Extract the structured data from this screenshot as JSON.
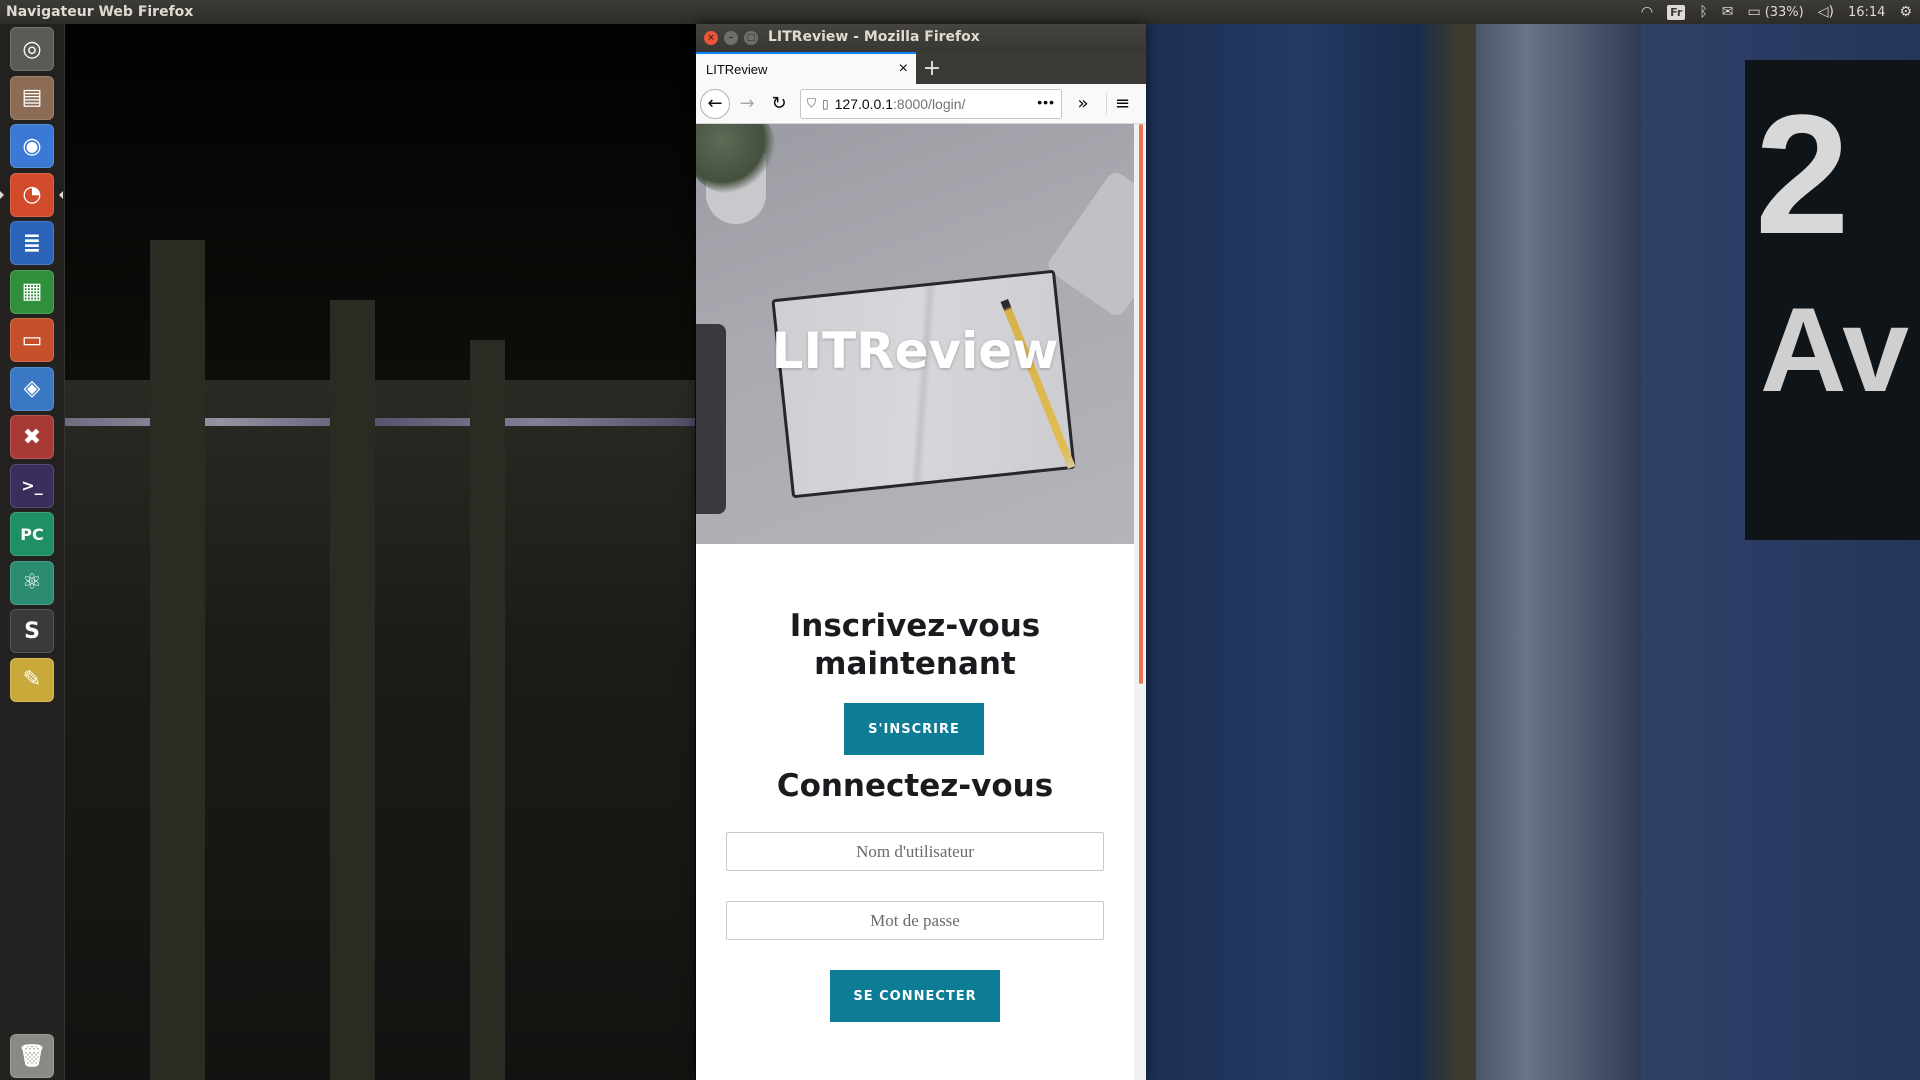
{
  "top_panel": {
    "app_title": "Navigateur Web Firefox",
    "keyboard_layout": "Fr",
    "battery": "(33%)",
    "clock": "16:14"
  },
  "launcher": {
    "items": [
      {
        "name": "dash-home-icon",
        "color": "#5b5a55",
        "glyph": "◎"
      },
      {
        "name": "files-icon",
        "color": "#8c6c55",
        "glyph": "▤"
      },
      {
        "name": "chrome-icon",
        "color": "#3b7ad4",
        "glyph": "◉"
      },
      {
        "name": "firefox-icon",
        "color": "#d24b2b",
        "glyph": "◔"
      },
      {
        "name": "writer-icon",
        "color": "#2a63b8",
        "glyph": "≣"
      },
      {
        "name": "calc-icon",
        "color": "#2f8f3b",
        "glyph": "▦"
      },
      {
        "name": "impress-icon",
        "color": "#c5502a",
        "glyph": "▭"
      },
      {
        "name": "software-center-icon",
        "color": "#3a78c4",
        "glyph": "◈"
      },
      {
        "name": "settings-icon",
        "color": "#a83a36",
        "glyph": "✖"
      },
      {
        "name": "terminal-icon",
        "color": "#3a2f5c",
        "glyph": ">_"
      },
      {
        "name": "pycharm-icon",
        "color": "#1f8f64",
        "glyph": "PC"
      },
      {
        "name": "atom-icon",
        "color": "#2c8c72",
        "glyph": "⚛"
      },
      {
        "name": "sublime-icon",
        "color": "#3a3a3a",
        "glyph": "S"
      },
      {
        "name": "text-editor-icon",
        "color": "#c9a93a",
        "glyph": "✎"
      }
    ],
    "trash_icon": "trash-icon"
  },
  "firefox": {
    "window_title": "LITReview - Mozilla Firefox",
    "tab_label": "LITReview",
    "url_host": "127.0.0.1",
    "url_path": ":8000/login/"
  },
  "page": {
    "hero_title": "LITReview",
    "signup_heading_line1": "Inscrivez-vous",
    "signup_heading_line2": "maintenant",
    "signup_button": "S'INSCRIRE",
    "login_heading": "Connectez-vous",
    "username_placeholder": "Nom d'utilisateur",
    "password_placeholder": "Mot de passe",
    "login_button": "SE CONNECTER",
    "accent_color": "#0d7c95"
  }
}
